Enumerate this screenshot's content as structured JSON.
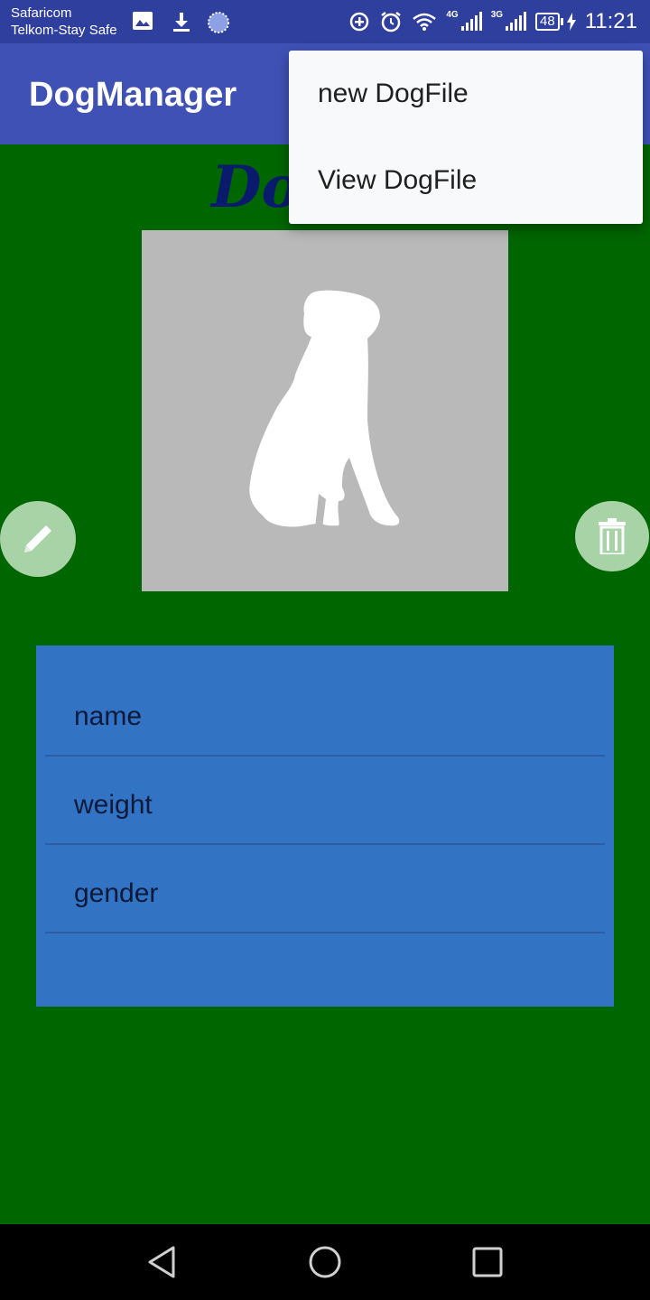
{
  "status_bar": {
    "carrier_1": "Safaricom",
    "carrier_2": "Telkom-Stay Safe",
    "network_1": "4G",
    "network_2": "3G",
    "battery": "48",
    "time": "11:21"
  },
  "app_bar": {
    "title": "DogManager"
  },
  "heading": {
    "visible_text": "Dog"
  },
  "overflow_menu": {
    "items": [
      {
        "label": "new DogFile"
      },
      {
        "label": "View DogFile"
      }
    ]
  },
  "dog_details": {
    "fields": [
      {
        "label": "name"
      },
      {
        "label": "weight"
      },
      {
        "label": "gender"
      },
      {
        "label": ""
      }
    ]
  },
  "colors": {
    "status_bar": "#2f3f9e",
    "app_bar": "#3f51b5",
    "background": "#006600",
    "details_panel": "#3273c4",
    "fab": "#a8d3a7",
    "photo_placeholder": "#b9b9b9",
    "menu": "#f8f9fa"
  },
  "icons": {
    "edit": "pencil-icon",
    "delete": "trash-icon",
    "nav_back": "back-triangle-icon",
    "nav_home": "home-circle-icon",
    "nav_recent": "recent-square-icon"
  }
}
